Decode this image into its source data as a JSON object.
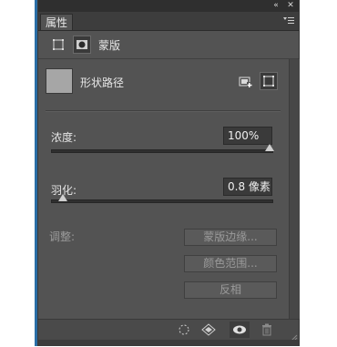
{
  "panel": {
    "tab_label": "属性",
    "menu_icon": "panel-menu-icon",
    "titlebar_icons": [
      "collapse-icon",
      "close-icon"
    ]
  },
  "mask_row": {
    "label": "蒙版"
  },
  "shape": {
    "label": "形状路径",
    "swatch_color": "#a6a6a6"
  },
  "density": {
    "label": "浓度:",
    "value": "100%",
    "slider_fraction": 1.0
  },
  "feather": {
    "label": "羽化:",
    "value": "0.8 像素",
    "slider_fraction": 0.03
  },
  "adjust": {
    "label": "调整:",
    "mask_edge_label": "蒙版边缘...",
    "color_range_label": "颜色范围...",
    "invert_label": "反相"
  },
  "bottom_icons": [
    "selection-from-mask-icon",
    "apply-mask-icon",
    "visibility-eye-icon",
    "trash-icon"
  ]
}
